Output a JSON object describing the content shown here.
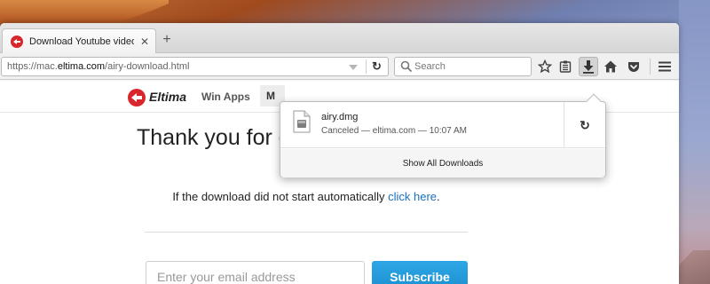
{
  "browser": {
    "tab": {
      "title": "Download Youtube videos on",
      "close_glyph": "✕",
      "favicon": "eltima-logo-icon"
    },
    "new_tab_glyph": "+",
    "url": {
      "prefix": "https://mac.",
      "domain": "eltima.com",
      "path": "/airy-download.html"
    },
    "reload_glyph": "↻",
    "search": {
      "placeholder": "Search"
    },
    "toolbar_icons": [
      "star-icon",
      "reading-list-icon",
      "downloads-icon",
      "home-icon",
      "pocket-icon",
      "menu-icon"
    ]
  },
  "site": {
    "logo_text": "Eltima",
    "nav": {
      "win_apps": "Win Apps",
      "mac": "M"
    },
    "thank_you": "Thank you for downloading Airy",
    "download_msg_before": "If the download did not start automatically ",
    "download_link": "click here",
    "download_msg_after": ".",
    "email_placeholder": "Enter your email address",
    "subscribe": "Subscribe"
  },
  "downloads_panel": {
    "item": {
      "filename": "airy.dmg",
      "status": "Canceled — eltima.com — 10:07 AM",
      "retry_glyph": "↻"
    },
    "show_all": "Show All Downloads"
  },
  "colors": {
    "accent": "#1b8fd0",
    "link": "#1a6fc0",
    "brand_red": "#d9262d"
  }
}
